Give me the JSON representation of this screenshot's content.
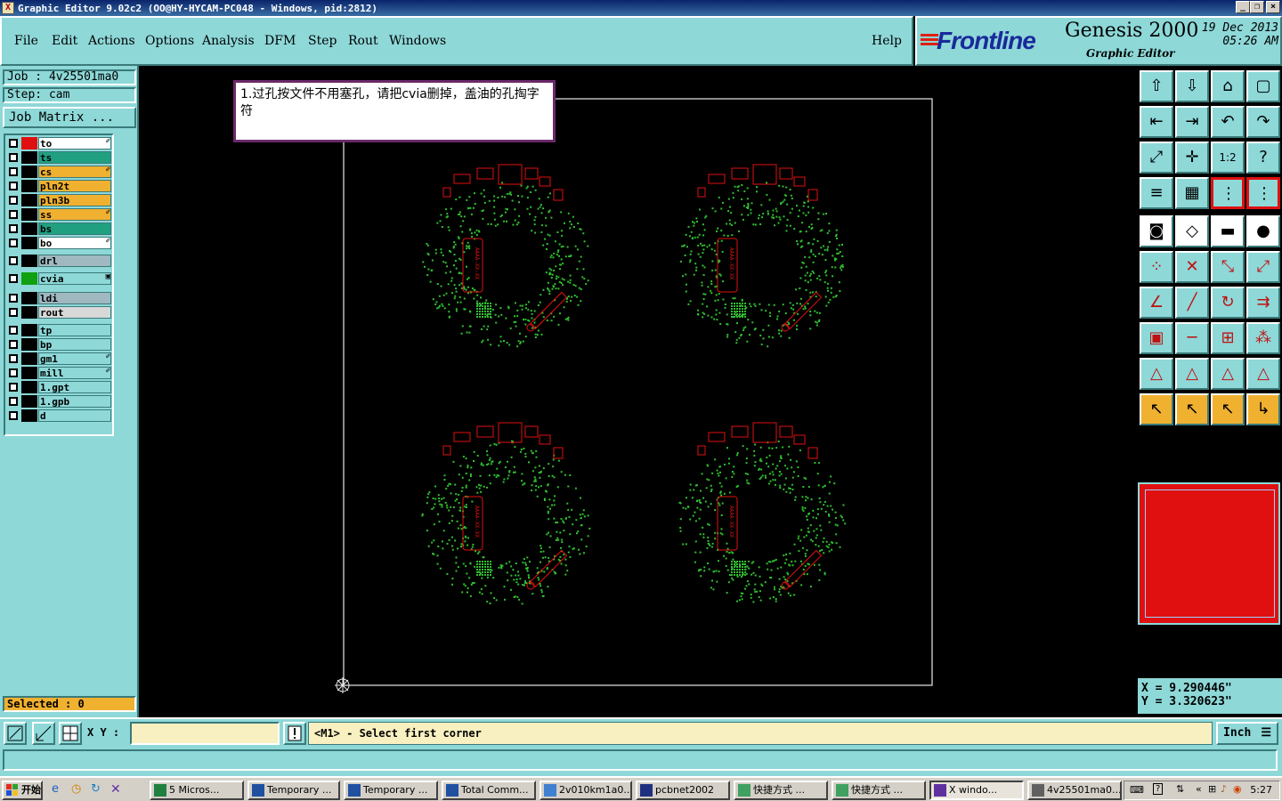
{
  "window": {
    "title": "Graphic Editor 9.02c2 (OO@HY-HYCAM-PC048 - Windows, pid:2812)",
    "buttons": [
      "_",
      "❐",
      "×"
    ]
  },
  "menu": {
    "items": [
      "File",
      "Edit",
      "Actions",
      "Options",
      "Analysis",
      "DFM",
      "Step",
      "Rout",
      "Windows"
    ],
    "help": "Help"
  },
  "brand": {
    "logo": "Frontline",
    "product": "Genesis 2000",
    "subtitle": "Graphic Editor",
    "date_line1": "19 Dec 2013",
    "date_line2": "05:26 AM"
  },
  "left": {
    "job": "Job : 4v25501ma0",
    "step": "Step: cam",
    "job_matrix": "Job Matrix ...",
    "selected": "Selected : 0",
    "layers": [
      {
        "name": "to",
        "swatch": "#e01010",
        "bg": "#ffffff",
        "mark": "✐"
      },
      {
        "name": "ts",
        "swatch": "#000000",
        "bg": "#20a080",
        "mark": ""
      },
      {
        "name": "cs",
        "swatch": "#000000",
        "bg": "#f0b030",
        "mark": "✐"
      },
      {
        "name": "pln2t",
        "swatch": "#000000",
        "bg": "#f0b030",
        "mark": ""
      },
      {
        "name": "pln3b",
        "swatch": "#000000",
        "bg": "#f0b030",
        "mark": ""
      },
      {
        "name": "ss",
        "swatch": "#000000",
        "bg": "#f0b030",
        "mark": "✐"
      },
      {
        "name": "bs",
        "swatch": "#000000",
        "bg": "#20a080",
        "mark": ""
      },
      {
        "name": "bo",
        "swatch": "#000000",
        "bg": "#ffffff",
        "mark": "✐"
      },
      {
        "name": "drl",
        "swatch": "#000000",
        "bg": "#a0b8c0",
        "mark": ""
      },
      {
        "name": "cvia",
        "swatch": "#10a010",
        "bg": "#8ed8d8",
        "mark": "▣"
      },
      {
        "name": "ldi",
        "swatch": "#000000",
        "bg": "#a0b8c0",
        "mark": ""
      },
      {
        "name": "rout",
        "swatch": "#000000",
        "bg": "#d8d8d8",
        "mark": ""
      },
      {
        "name": "tp",
        "swatch": "#000000",
        "bg": "#8ed8d8",
        "mark": ""
      },
      {
        "name": "bp",
        "swatch": "#000000",
        "bg": "#8ed8d8",
        "mark": ""
      },
      {
        "name": "gm1",
        "swatch": "#000000",
        "bg": "#8ed8d8",
        "mark": "✐"
      },
      {
        "name": "mill",
        "swatch": "#000000",
        "bg": "#8ed8d8",
        "mark": "✐"
      },
      {
        "name": "1.gpt",
        "swatch": "#000000",
        "bg": "#8ed8d8",
        "mark": ""
      },
      {
        "name": "1.gpb",
        "swatch": "#000000",
        "bg": "#8ed8d8",
        "mark": ""
      },
      {
        "name": "d",
        "swatch": "#000000",
        "bg": "#8ed8d8",
        "mark": ""
      }
    ]
  },
  "canvas": {
    "note": "1.过孔按文件不用塞孔，请把cvia删掉，盖油的孔掏字符",
    "board_label": "AAAA-XX-XX"
  },
  "right": {
    "coord_x": "X = 9.290446\"",
    "coord_y": "Y = 3.320623\"",
    "ratio_label": "1:2"
  },
  "command": {
    "xy_label": "X Y :",
    "xy_value": "",
    "prompt": "<M1> - Select first corner",
    "units": "Inch"
  },
  "taskbar": {
    "start": "开始",
    "tasks": [
      "5 Micros...",
      "Temporary ...",
      "Temporary ...",
      "Total Comm...",
      "2v010km1a0...",
      "pcbnet2002",
      "快捷方式 ...",
      "快捷方式 ...",
      "X windo...",
      "4v25501ma0..."
    ],
    "clock": "5:27"
  },
  "colors": {
    "panel": "#8ed8d8",
    "canvas": "#000000",
    "feature_red": "#e01010",
    "feature_green": "#30c030"
  }
}
